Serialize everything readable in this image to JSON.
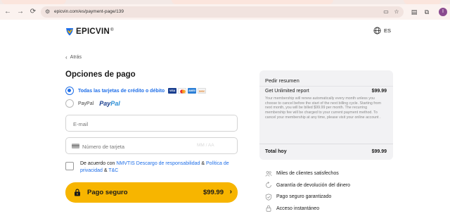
{
  "browser": {
    "url": "epicvin.com/es/payment-page/139",
    "nav_back": "←",
    "nav_forward": "→",
    "reload": "⟳",
    "profile_initial": "I"
  },
  "header": {
    "logo_text_1": "EPIC",
    "logo_text_2": "VIN",
    "logo_reg": "®",
    "language": "ES"
  },
  "back_link": "Atrás",
  "page_title": "Opciones de pago",
  "payment_options": {
    "cards_label": "Todas las tarjetas de crédito o débito",
    "card_brands": [
      "VISA",
      "MC",
      "AMEX",
      "DISC"
    ],
    "paypal_label": "PayPal",
    "paypal_logo_1": "Pay",
    "paypal_logo_2": "Pal"
  },
  "form": {
    "email_placeholder": "E-mail",
    "card_placeholder": "Número de tarjeta",
    "expiry_placeholder": "MM / AA"
  },
  "consent": {
    "prefix": "De acuerdo con ",
    "disclaimer_link": "NMVTIS Descargo de responsabilidad",
    "and_1": " & ",
    "privacy_link": "Política de privacidad",
    "and_2": " & ",
    "tc_link": "T&C"
  },
  "pay_button": {
    "label": "Pago seguro",
    "price": "$99.99",
    "chevron": "›"
  },
  "summary": {
    "title": "Pedir resumen",
    "item": "Get Unlimited report",
    "item_price": "$99.99",
    "description": "Your membership will renew automatically every month unless you choose to cancel before the start of the next billing cycle. Starting from next month, you will be billed $99.99 per month. The recurring membership fee will be charged to your current payment method. To cancel your membership at any time, please visit your online account .",
    "total_label": "Total hoy",
    "total_price": "$99.99"
  },
  "benefits": [
    {
      "icon": "people-icon",
      "label": "Miles de clientes satisfechos"
    },
    {
      "icon": "refund-icon",
      "label": "Garantía de devolución del dinero"
    },
    {
      "icon": "shield-icon",
      "label": "Pago seguro garantizado"
    },
    {
      "icon": "lock-icon",
      "label": "Acceso instantáneo"
    }
  ],
  "colors": {
    "accent_blue": "#1e6ee8",
    "pay_button": "#f7b500",
    "summary_bg": "#f2f2f4"
  }
}
